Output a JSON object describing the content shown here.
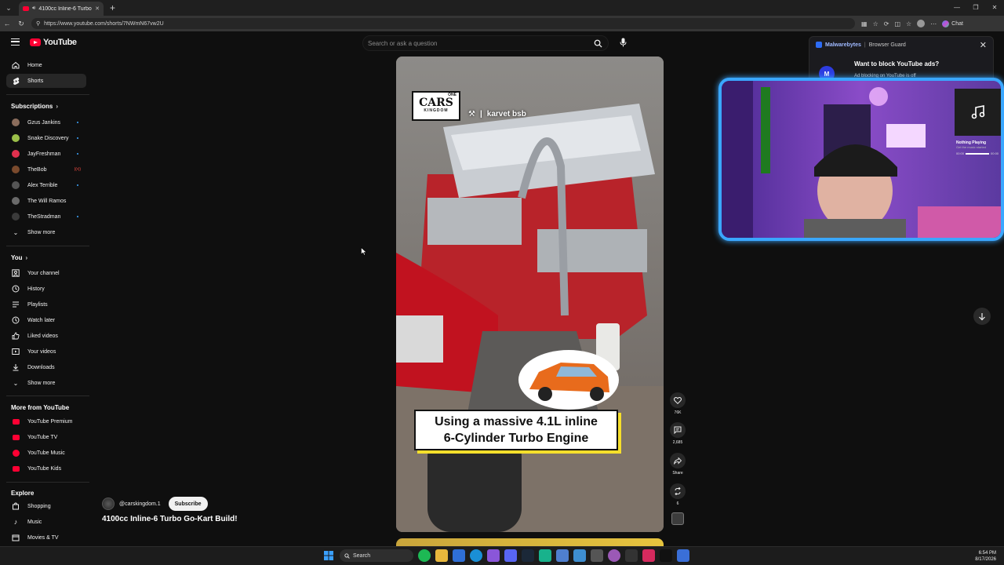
{
  "browser": {
    "tab_title": "4100cc Inline-6 Turbo Go-Kart",
    "url": "https://www.youtube.com/shorts/7NWmN67vw2U",
    "chat_label": "Chat"
  },
  "header": {
    "logo_text": "YouTube",
    "search_placeholder": "Search or ask a question"
  },
  "sidebar": {
    "top": [
      {
        "label": "Home",
        "icon": "home-icon"
      },
      {
        "label": "Shorts",
        "icon": "shorts-icon"
      }
    ],
    "subscriptions_heading": "Subscriptions",
    "subscriptions": [
      {
        "label": "Gzus Jankins",
        "color": "#8b6d5c",
        "badge": "dot"
      },
      {
        "label": "Snake Discovery",
        "color": "#9bbf49",
        "badge": "dot"
      },
      {
        "label": "JayFreshman",
        "color": "#e0304e",
        "badge": "dot"
      },
      {
        "label": "TheBob",
        "color": "#7a4a2d",
        "badge": "live"
      },
      {
        "label": "Alex Terrible",
        "color": "#555555",
        "badge": "dot"
      },
      {
        "label": "The Will Ramos",
        "color": "#6a6a6a",
        "badge": "none"
      },
      {
        "label": "TheStradman",
        "color": "#3a3a3a",
        "badge": "dot"
      }
    ],
    "show_more": "Show more",
    "you_heading": "You",
    "you_items": [
      {
        "label": "Your channel",
        "icon": "channel-icon"
      },
      {
        "label": "History",
        "icon": "history-icon"
      },
      {
        "label": "Playlists",
        "icon": "playlists-icon"
      },
      {
        "label": "Watch later",
        "icon": "clock-icon"
      },
      {
        "label": "Liked videos",
        "icon": "thumb-up-icon"
      },
      {
        "label": "Your videos",
        "icon": "video-icon"
      },
      {
        "label": "Downloads",
        "icon": "download-icon"
      }
    ],
    "show_more_2": "Show more",
    "more_heading": "More from YouTube",
    "more_items": [
      {
        "label": "YouTube Premium"
      },
      {
        "label": "YouTube TV"
      },
      {
        "label": "YouTube Music"
      },
      {
        "label": "YouTube Kids"
      }
    ],
    "explore_heading": "Explore",
    "explore_items": [
      {
        "label": "Shopping",
        "icon": "shopping-bag-icon"
      },
      {
        "label": "Music",
        "icon": "music-note-icon"
      },
      {
        "label": "Movies & TV",
        "icon": "film-icon"
      }
    ]
  },
  "short": {
    "overlay_brand": "CARS",
    "overlay_brand_top": "ONE",
    "overlay_brand_bottom": "KINGDOM",
    "overlay_credit": "karvet bsb",
    "caption_line1": "Using a massive 4.1L inline",
    "caption_line2": "6-Cylinder Turbo Engine",
    "channel_handle": "@carskingdom.1",
    "subscribe_label": "Subscribe",
    "title": "4100cc Inline-6 Turbo Go-Kart Build!"
  },
  "actions": {
    "likes": "76K",
    "comments": "2,685",
    "share": "Share",
    "remix": "6"
  },
  "malwarebytes": {
    "brand": "Malwarebytes",
    "product": "Browser Guard",
    "question": "Want to block YouTube ads?",
    "status": "Ad blocking on YouTube is off"
  },
  "stream_overlay": {
    "now_playing": "Nothing Playing",
    "now_playing_sub": "Get the music started",
    "time_start": "00:00",
    "time_end": "00:00"
  },
  "taskbar": {
    "search_label": "Search",
    "time": "6:54 PM",
    "date": "8/17/2026"
  }
}
